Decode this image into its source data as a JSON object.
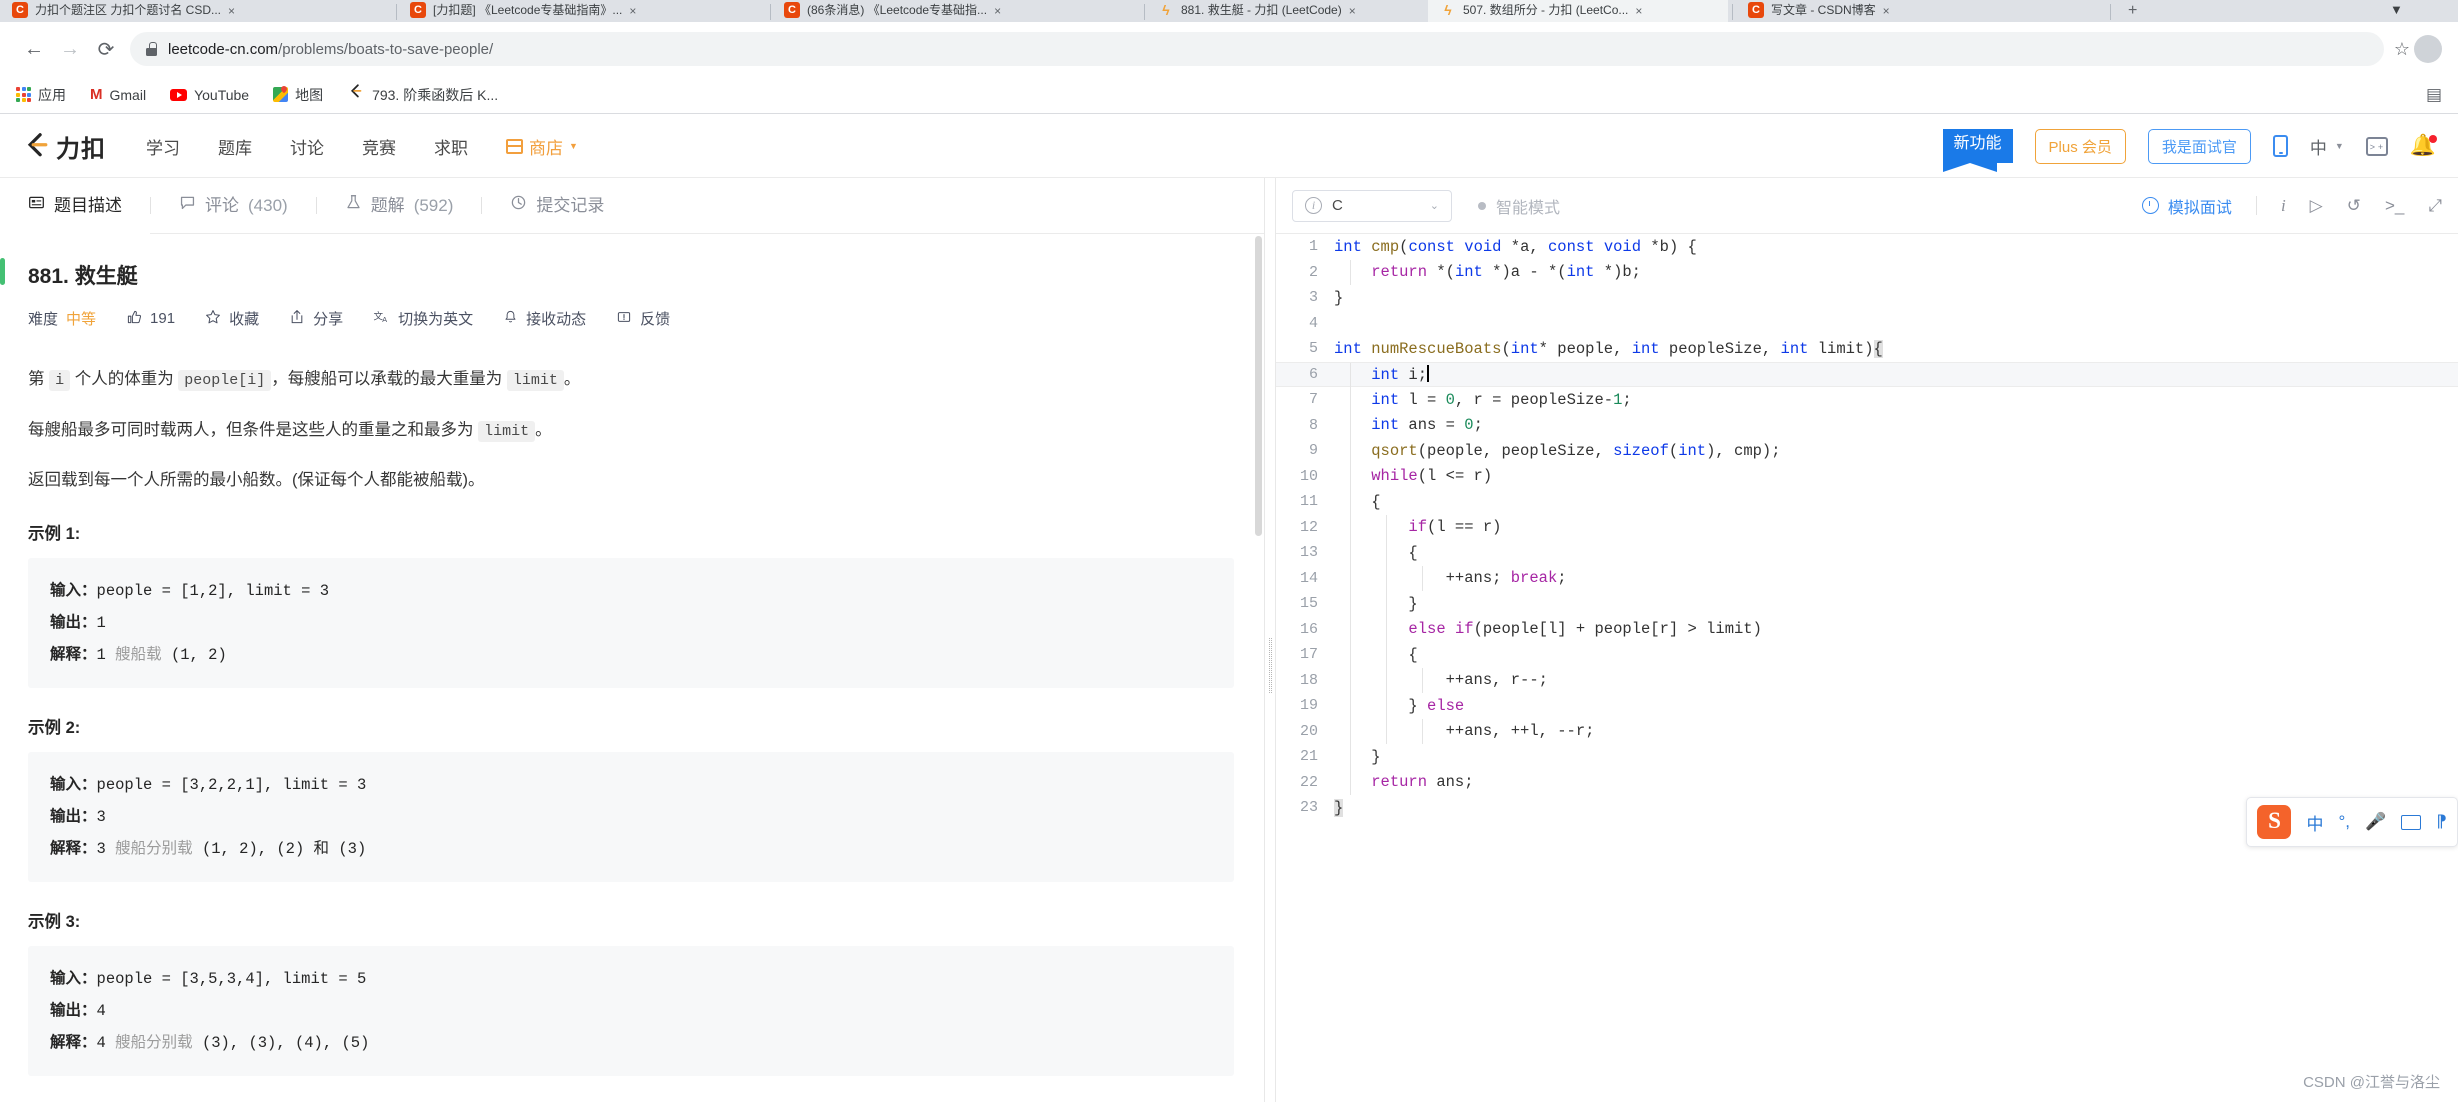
{
  "browser": {
    "tabs": [
      {
        "title": "力扣个题注区 力扣个题讨名 CSD...",
        "favicon": "csdn-icon",
        "active": false
      },
      {
        "title": "[力扣题] 《Leetcode专基础指南》...",
        "favicon": "csdn-icon",
        "active": false
      },
      {
        "title": "(86条消息) 《Leetcode专基础指...",
        "favicon": "csdn-icon",
        "active": false
      },
      {
        "title": "881. 救生艇 - 力扣 (LeetCode)",
        "favicon": "leetcode-icon",
        "active": false
      },
      {
        "title": "507. 数组所分 - 力扣 (LeetCo...",
        "favicon": "leetcode-icon",
        "active": true
      },
      {
        "title": "写文章 - CSDN博客",
        "favicon": "csdn-icon",
        "active": false
      }
    ],
    "new_tab_label": "+",
    "nav": {
      "back": "←",
      "forward": "→",
      "reload": "⟳"
    },
    "url_prefix": "leetcode-cn.com",
    "url_suffix": "/problems/boats-to-save-people/",
    "star_icon": "☆",
    "lock_icon": "lock-icon",
    "menu_icon": "⋮"
  },
  "bookmarks": [
    {
      "label": "应用",
      "icon": "apps-grid-icon"
    },
    {
      "label": "Gmail",
      "icon": "gmail-icon"
    },
    {
      "label": "YouTube",
      "icon": "youtube-icon"
    },
    {
      "label": "地图",
      "icon": "maps-icon"
    },
    {
      "label": "793. 阶乘函数后 K...",
      "icon": "leetcode-icon"
    }
  ],
  "bookmarks_right_icon": "reading-list-icon",
  "lc_header": {
    "logo": "力扣",
    "nav": [
      "学习",
      "题库",
      "讨论",
      "竞赛",
      "求职"
    ],
    "shop": "商店",
    "new_feature_badge": "新功能",
    "plus_member": "Plus 会员",
    "interviewer": "我是面试官",
    "language": "中",
    "icons": [
      "phone-icon",
      "terminal-icon",
      "bell-icon"
    ]
  },
  "problem_tabs": [
    {
      "label": "题目描述",
      "icon": "description-icon",
      "count": "",
      "active": true
    },
    {
      "label": "评论",
      "icon": "comment-icon",
      "count": "(430)",
      "active": false
    },
    {
      "label": "题解",
      "icon": "solution-icon",
      "count": "(592)",
      "active": false
    },
    {
      "label": "提交记录",
      "icon": "history-icon",
      "count": "",
      "active": false
    }
  ],
  "problem": {
    "title": "881. 救生艇",
    "difficulty_label": "难度",
    "difficulty_value": "中等",
    "likes": "191",
    "favorite": "收藏",
    "share": "分享",
    "switch_lang": "切换为英文",
    "subscribe": "接收动态",
    "feedback": "反馈",
    "desc": [
      {
        "pre": "第 ",
        "code1": "i",
        "mid": " 个人的体重为 ",
        "code2": "people[i]",
        "mid2": "，每艘船可以承载的最大重量为 ",
        "code3": "limit",
        "post": "。"
      },
      {
        "pre": "每艘船最多可同时载两人，但条件是这些人的重量之和最多为 ",
        "code1": "limit",
        "post": "。"
      },
      {
        "pre": "返回载到每一个人所需的最小船数。(保证每个人都能被船载)。"
      }
    ],
    "examples": [
      {
        "title": "示例 1:",
        "input_label": "输入：",
        "input": "people = [1,2], limit = 3",
        "output_label": "输出：",
        "output": "1",
        "explain_label": "解释：",
        "explain_num": "1 ",
        "explain_gray": "艘船载",
        "explain_rest": " (1, 2)"
      },
      {
        "title": "示例 2:",
        "input_label": "输入：",
        "input": "people = [3,2,2,1], limit = 3",
        "output_label": "输出：",
        "output": "3",
        "explain_label": "解释：",
        "explain_num": "3 ",
        "explain_gray": "艘船分别载",
        "explain_rest": " (1, 2), (2) 和 (3)"
      },
      {
        "title": "示例 3:",
        "input_label": "输入：",
        "input": "people = [3,5,3,4], limit = 5",
        "output_label": "输出：",
        "output": "4",
        "explain_label": "解释：",
        "explain_num": "4 ",
        "explain_gray": "艘船分别载",
        "explain_rest": " (3), (3), (4), (5)"
      }
    ]
  },
  "editor": {
    "language": "C",
    "smart_mode": "智能模式",
    "mock_interview": "模拟面试",
    "toolbar_icons": [
      "info-icon",
      "flag-icon",
      "reset-icon",
      "console-icon",
      "fullscreen-icon"
    ],
    "cursor_line": 6,
    "code_lines": [
      {
        "n": 1,
        "text": "int cmp(const void *a, const void *b) {"
      },
      {
        "n": 2,
        "text": "    return *(int *)a - *(int *)b;"
      },
      {
        "n": 3,
        "text": "}"
      },
      {
        "n": 4,
        "text": ""
      },
      {
        "n": 5,
        "text": "int numRescueBoats(int* people, int peopleSize, int limit){"
      },
      {
        "n": 6,
        "text": "    int i;"
      },
      {
        "n": 7,
        "text": "    int l = 0, r = peopleSize-1;"
      },
      {
        "n": 8,
        "text": "    int ans = 0;"
      },
      {
        "n": 9,
        "text": "    qsort(people, peopleSize, sizeof(int), cmp);"
      },
      {
        "n": 10,
        "text": "    while(l <= r)"
      },
      {
        "n": 11,
        "text": "    {"
      },
      {
        "n": 12,
        "text": "        if(l == r)"
      },
      {
        "n": 13,
        "text": "        {"
      },
      {
        "n": 14,
        "text": "            ++ans; break;"
      },
      {
        "n": 15,
        "text": "        }"
      },
      {
        "n": 16,
        "text": "        else if(people[l] + people[r] > limit)"
      },
      {
        "n": 17,
        "text": "        {"
      },
      {
        "n": 18,
        "text": "            ++ans, r--;"
      },
      {
        "n": 19,
        "text": "        } else"
      },
      {
        "n": 20,
        "text": "            ++ans, ++l, --r;"
      },
      {
        "n": 21,
        "text": "    }"
      },
      {
        "n": 22,
        "text": "    return ans;"
      },
      {
        "n": 23,
        "text": "}"
      }
    ]
  },
  "ime": {
    "logo": "S",
    "mode": "中",
    "punct": "°,",
    "mic": "mic-icon",
    "keyboard": "keyboard-icon",
    "more": "more-icon"
  },
  "watermark": "CSDN @江誉与洛尘",
  "colors": {
    "accent_blue": "#3b8cf0",
    "orange": "#f0a33a",
    "green": "#44c073",
    "keyword_blue": "#0d39e8",
    "keyword_purple": "#a626a4"
  }
}
